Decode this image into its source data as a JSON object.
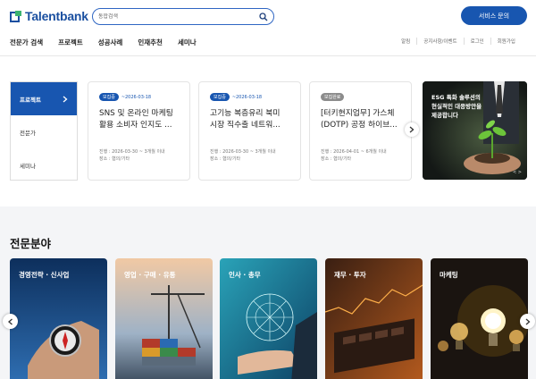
{
  "header": {
    "logo_text": "Talentbank",
    "search_placeholder": "통합검색",
    "inquiry_button": "서비스 문의"
  },
  "nav": [
    "전문가 검색",
    "프로젝트",
    "성공사례",
    "인재추천",
    "세미나"
  ],
  "util": [
    "알림",
    "공지사항/이벤트",
    "로그인",
    "회원가입"
  ],
  "side_tabs": [
    {
      "label": "프로젝트",
      "active": true
    },
    {
      "label": "전문가",
      "active": false
    },
    {
      "label": "세미나",
      "active": false
    }
  ],
  "cards": [
    {
      "badge": "모집중",
      "date": "~2026-03-18",
      "title": "SNS 및 온라인 마케팅 활용 소비자 인지도 ...",
      "period": "진행 : 2026-03-30 ~ 3개월 이내",
      "place": "장소 : 협의/기타"
    },
    {
      "badge": "모집중",
      "date": "~2026-03-18",
      "title": "고기능 복층유리 북미 시장 직수출 네트워...",
      "period": "진행 : 2026-03-30 ~ 3개월 이내",
      "place": "장소 : 협의/기타"
    },
    {
      "badge": "모집완료",
      "date": "",
      "title": "[터키현지업무] 가스체 (DOTP) 공정 하이브...",
      "period": "진행 : 2026-04-01 ~ 6개월 이내",
      "place": "장소 : 협의/기타"
    }
  ],
  "esg": {
    "line1": "ESG 특화 솔루션의",
    "line2": "현실적인 대응방안을",
    "line3": "제공합니다",
    "pager": "< >"
  },
  "section_title": "전문분야",
  "fields": [
    "경영전략 · 신사업",
    "영업 · 구매 · 유통",
    "인사 · 총무",
    "재무 · 투자",
    "마케팅"
  ],
  "colors": {
    "primary": "#1856b0",
    "badge_ended": "#8c8c8c",
    "section_bg": "#f4f5f7"
  }
}
